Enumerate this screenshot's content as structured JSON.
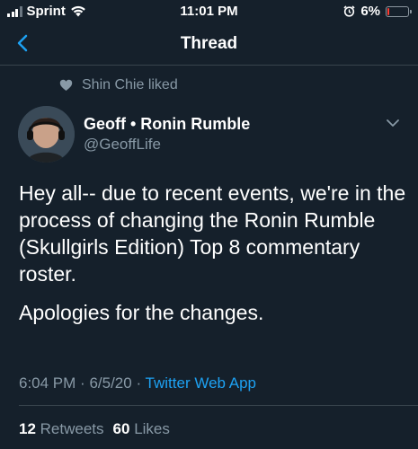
{
  "status_bar": {
    "carrier": "Sprint",
    "time": "11:01 PM",
    "battery_percent": "6%",
    "battery_level": 0.06,
    "battery_color": "#ff3b30",
    "icons": [
      "signal-icon",
      "wifi-icon",
      "alarm-icon",
      "battery-icon"
    ]
  },
  "nav": {
    "title": "Thread",
    "back_icon": "chevron-left-icon",
    "accent": "#1da1f2"
  },
  "social_context": {
    "icon": "heart-icon",
    "text": "Shin Chie liked"
  },
  "tweet": {
    "author_name": "Geoff • Ronin Rumble",
    "handle": "@GeoffLife",
    "paragraphs": [
      "Hey all-- due to recent events, we're in the process of changing the Ronin Rumble (Skullgirls Edition) Top 8 commentary roster.",
      "Apologies for the changes."
    ],
    "time": "6:04 PM",
    "date": "6/5/20",
    "source": "Twitter Web App",
    "retweets_count": "12",
    "retweets_label": "Retweets",
    "likes_count": "60",
    "likes_label": "Likes"
  },
  "colors": {
    "background": "#15202b",
    "secondary_text": "#8899a6",
    "divider": "#38444d",
    "link": "#1da1f2"
  }
}
